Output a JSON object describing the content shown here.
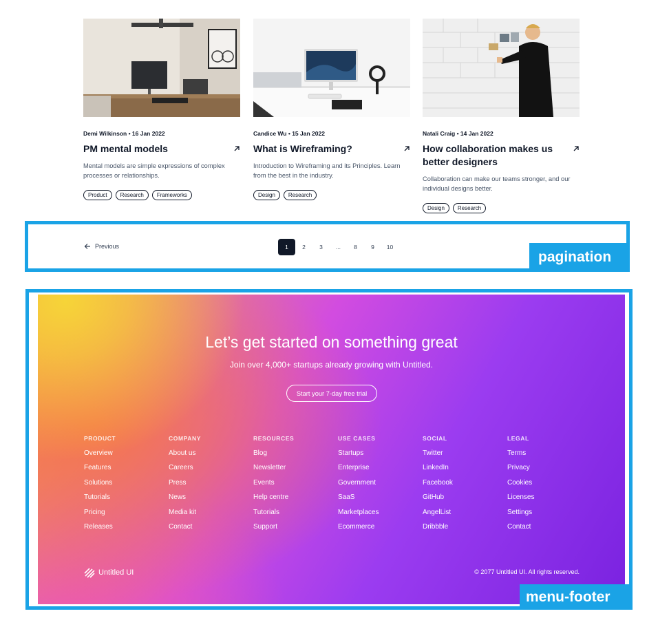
{
  "cards": [
    {
      "meta": "Demi Wilkinson • 16 Jan 2022",
      "title": "PM mental models",
      "description": "Mental models are simple expressions of complex processes or relationships.",
      "tags": [
        "Product",
        "Research",
        "Frameworks"
      ]
    },
    {
      "meta": "Candice Wu • 15 Jan 2022",
      "title": "What is Wireframing?",
      "description": "Introduction to Wireframing and its Principles. Learn from the best in the industry.",
      "tags": [
        "Design",
        "Research"
      ]
    },
    {
      "meta": "Natali Craig • 14 Jan 2022",
      "title": "How collaboration makes us better designers",
      "description": "Collaboration can make our teams stronger, and our individual designs better.",
      "tags": [
        "Design",
        "Research"
      ]
    }
  ],
  "pagination": {
    "previous_label": "Previous",
    "pages": [
      "1",
      "2",
      "3",
      "...",
      "8",
      "9",
      "10"
    ],
    "current_page": "1",
    "annotation": "pagination"
  },
  "footer": {
    "cta_title": "Let’s get started on something great",
    "cta_subtitle": "Join over 4,000+ startups already growing with Untitled.",
    "cta_button": "Start your 7-day free trial",
    "columns": [
      {
        "heading": "PRODUCT",
        "links": [
          "Overview",
          "Features",
          "Solutions",
          "Tutorials",
          "Pricing",
          "Releases"
        ]
      },
      {
        "heading": "COMPANY",
        "links": [
          "About us",
          "Careers",
          "Press",
          "News",
          "Media kit",
          "Contact"
        ]
      },
      {
        "heading": "RESOURCES",
        "links": [
          "Blog",
          "Newsletter",
          "Events",
          "Help centre",
          "Tutorials",
          "Support"
        ]
      },
      {
        "heading": "USE CASES",
        "links": [
          "Startups",
          "Enterprise",
          "Government",
          "SaaS",
          "Marketplaces",
          "Ecommerce"
        ]
      },
      {
        "heading": "SOCIAL",
        "links": [
          "Twitter",
          "LinkedIn",
          "Facebook",
          "GitHub",
          "AngelList",
          "Dribbble"
        ]
      },
      {
        "heading": "LEGAL",
        "links": [
          "Terms",
          "Privacy",
          "Cookies",
          "Licenses",
          "Settings",
          "Contact"
        ]
      }
    ],
    "logo_text": "Untitled UI",
    "copyright": "© 2077 Untitled UI. All rights reserved.",
    "annotation": "menu-footer"
  },
  "colors": {
    "annotation_blue": "#1aa3e6",
    "text_dark": "#101828",
    "active_page": "#101828"
  }
}
